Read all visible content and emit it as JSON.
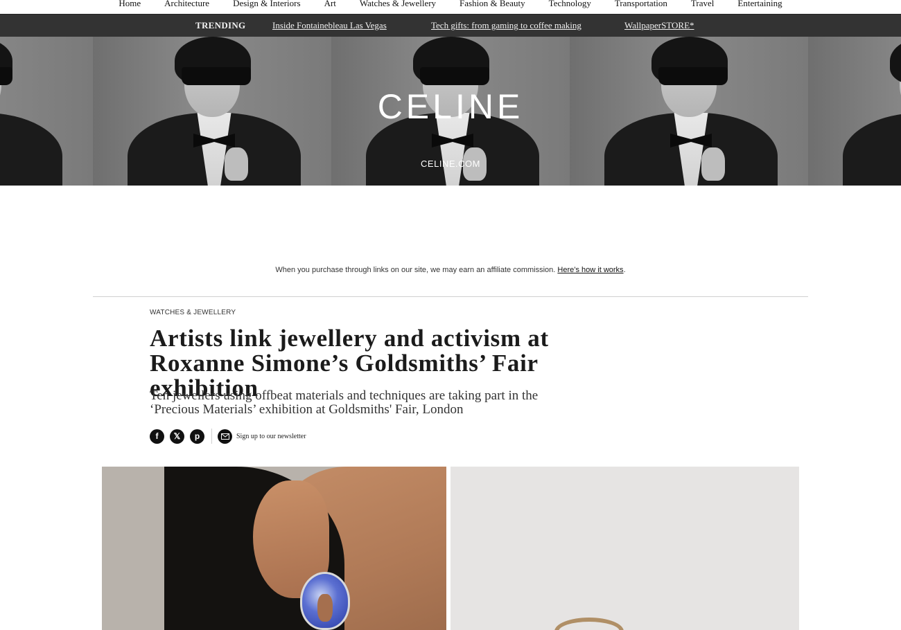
{
  "nav": {
    "items": [
      "Home",
      "Architecture",
      "Design & Interiors",
      "Art",
      "Watches & Jewellery",
      "Fashion & Beauty",
      "Technology",
      "Transportation",
      "Travel",
      "Entertaining"
    ]
  },
  "trending": {
    "label": "TRENDING",
    "links": [
      "Inside Fontainebleau Las Vegas",
      "Tech gifts: from gaming to coffee making",
      "WallpaperSTORE*"
    ]
  },
  "ad": {
    "brand": "CELINE",
    "url": "CELINE.COM"
  },
  "affiliate": {
    "text": "When you purchase through links on our site, we may earn an affiliate commission.",
    "link": "Here’s how it works"
  },
  "article": {
    "category": "WATCHES & JEWELLERY",
    "headline": "Artists link jewellery and activism at Roxanne Simone’s Goldsmiths’ Fair exhibition",
    "dek": "Ten jewellers using offbeat materials and techniques are taking part in the ‘Precious Materials’ exhibition at Goldsmiths' Fair, London",
    "newsletter": "Sign up to our newsletter"
  },
  "share": {
    "facebook_glyph": "f",
    "x_glyph": "𝕏",
    "pinterest_glyph": "p"
  }
}
